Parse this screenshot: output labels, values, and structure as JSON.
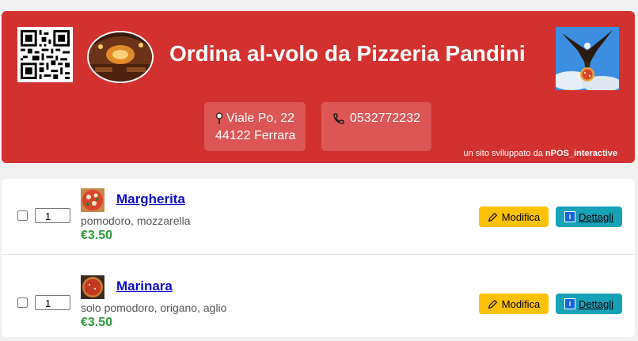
{
  "header": {
    "title": "Ordina al-volo da Pizzeria Pandini",
    "address_line1": "Viale Po, 22",
    "address_line2": "44122 Ferrara",
    "phone": "0532772232",
    "credit_prefix": "un sito sviluppato da ",
    "credit_brand": "nPOS_interactive",
    "colors": {
      "background": "#d3312f",
      "text": "#ffffff"
    }
  },
  "products": [
    {
      "name": "Margherita",
      "description": "pomodoro, mozzarella",
      "price": "€3.50",
      "quantity": "1",
      "modify_label": "Modifica",
      "details_label": "Dettagli"
    },
    {
      "name": "Marinara",
      "description": "solo pomodoro, origano, aglio",
      "price": "€3.50",
      "quantity": "1",
      "modify_label": "Modifica",
      "details_label": "Dettagli"
    }
  ],
  "colors": {
    "modify_button": "#fdc107",
    "details_button": "#17a2b8",
    "price": "#2e9a3a",
    "link": "#0c0cc8"
  }
}
